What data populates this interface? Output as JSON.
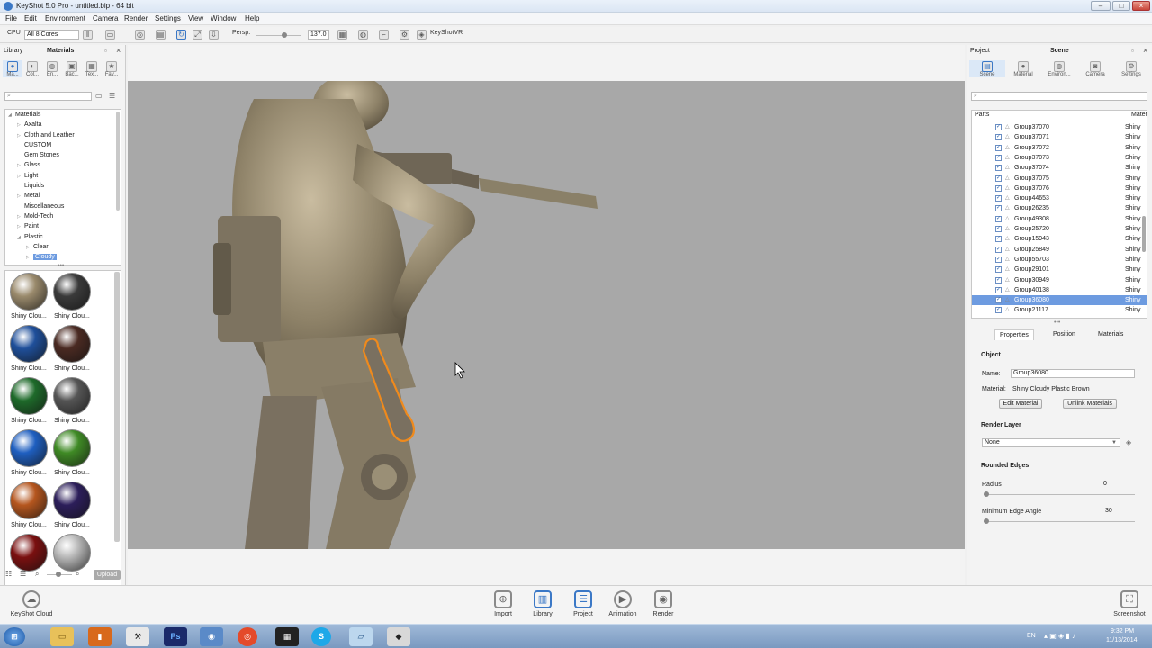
{
  "window": {
    "title": "KeyShot 5.0 Pro - untitled.bip - 64 bit"
  },
  "menu": [
    "File",
    "Edit",
    "Environment",
    "Camera",
    "Render",
    "Settings",
    "View",
    "Window",
    "Help"
  ],
  "toolbar": {
    "cpu_label": "CPU",
    "cores": "All 8 Cores",
    "perspective": "Persp.",
    "fov": "137.0",
    "keyshotvr": "KeyShotVR"
  },
  "library": {
    "title": "Library",
    "tab_title": "Materials",
    "tabs": [
      "Ma...",
      "Col...",
      "En...",
      "Bac...",
      "Tex...",
      "Fav..."
    ],
    "tree": [
      {
        "label": "Materials",
        "level": 0,
        "arrow": "◢"
      },
      {
        "label": "Axalta",
        "level": 1,
        "arrow": "▷"
      },
      {
        "label": "Cloth and Leather",
        "level": 1,
        "arrow": "▷"
      },
      {
        "label": "CUSTOM",
        "level": 1,
        "arrow": ""
      },
      {
        "label": "Gem Stones",
        "level": 1,
        "arrow": ""
      },
      {
        "label": "Glass",
        "level": 1,
        "arrow": "▷"
      },
      {
        "label": "Light",
        "level": 1,
        "arrow": "▷"
      },
      {
        "label": "Liquids",
        "level": 1,
        "arrow": ""
      },
      {
        "label": "Metal",
        "level": 1,
        "arrow": "▷"
      },
      {
        "label": "Miscellaneous",
        "level": 1,
        "arrow": ""
      },
      {
        "label": "Mold-Tech",
        "level": 1,
        "arrow": "▷"
      },
      {
        "label": "Paint",
        "level": 1,
        "arrow": "▷"
      },
      {
        "label": "Plastic",
        "level": 1,
        "arrow": "◢"
      },
      {
        "label": "Clear",
        "level": 2,
        "arrow": "▷"
      },
      {
        "label": "Cloudy",
        "level": 2,
        "arrow": "▷"
      }
    ],
    "thumbs": [
      {
        "label": "Shiny Clou...",
        "color": "#9a8a6c"
      },
      {
        "label": "Shiny Clou...",
        "color": "#3a3a3a"
      },
      {
        "label": "Shiny Clou...",
        "color": "#1f4f9a"
      },
      {
        "label": "Shiny Clou...",
        "color": "#4a2a22"
      },
      {
        "label": "Shiny Clou...",
        "color": "#1e6a2a"
      },
      {
        "label": "Shiny Clou...",
        "color": "#555555"
      },
      {
        "label": "Shiny Clou...",
        "color": "#1f5fc0"
      },
      {
        "label": "Shiny Clou...",
        "color": "#3f8a25"
      },
      {
        "label": "Shiny Clou...",
        "color": "#b5561e"
      },
      {
        "label": "Shiny Clou...",
        "color": "#2c1e5a"
      },
      {
        "label": "",
        "color": "#7a1010"
      },
      {
        "label": "",
        "color": "#b8b8b8"
      }
    ],
    "upload": "Upload"
  },
  "project": {
    "title": "Project",
    "tab_title": "Scene",
    "tabs": [
      "Scene",
      "Material",
      "Environ...",
      "Camera",
      "Settings"
    ],
    "parts_header": "Parts",
    "material_header": "Mater",
    "parts": [
      {
        "name": "Group37070",
        "mat": "Shiny"
      },
      {
        "name": "Group37071",
        "mat": "Shiny"
      },
      {
        "name": "Group37072",
        "mat": "Shiny"
      },
      {
        "name": "Group37073",
        "mat": "Shiny"
      },
      {
        "name": "Group37074",
        "mat": "Shiny"
      },
      {
        "name": "Group37075",
        "mat": "Shiny"
      },
      {
        "name": "Group37076",
        "mat": "Shiny"
      },
      {
        "name": "Group44653",
        "mat": "Shiny"
      },
      {
        "name": "Group26235",
        "mat": "Shiny"
      },
      {
        "name": "Group49308",
        "mat": "Shiny"
      },
      {
        "name": "Group25720",
        "mat": "Shiny"
      },
      {
        "name": "Group15943",
        "mat": "Shiny"
      },
      {
        "name": "Group25849",
        "mat": "Shiny"
      },
      {
        "name": "Group55703",
        "mat": "Shiny"
      },
      {
        "name": "Group29101",
        "mat": "Shiny"
      },
      {
        "name": "Group30949",
        "mat": "Shiny"
      },
      {
        "name": "Group40138",
        "mat": "Shiny"
      },
      {
        "name": "Group36080",
        "mat": "Shiny"
      },
      {
        "name": "Group21117",
        "mat": "Shiny"
      }
    ],
    "prop_tabs": [
      "Properties",
      "Position",
      "Materials"
    ],
    "object_header": "Object",
    "name_label": "Name:",
    "name_value": "Group36080",
    "material_label": "Material:",
    "material_value": "Shiny Cloudy Plastic Brown",
    "edit_material": "Edit Material",
    "unlink_materials": "Unlink Materials",
    "render_layer_header": "Render Layer",
    "render_layer_value": "None",
    "rounded_edges_header": "Rounded Edges",
    "radius_label": "Radius",
    "radius_value": "0",
    "min_edge_label": "Minimum Edge Angle",
    "min_edge_value": "30"
  },
  "bottom": {
    "keyshot_cloud": "KeyShot Cloud",
    "buttons": [
      "Import",
      "Library",
      "Project",
      "Animation",
      "Render"
    ],
    "screenshot": "Screenshot"
  },
  "taskbar": {
    "apps": [
      "Ps"
    ],
    "lang": "EN",
    "time": "9:32 PM",
    "date": "11/13/2014"
  }
}
